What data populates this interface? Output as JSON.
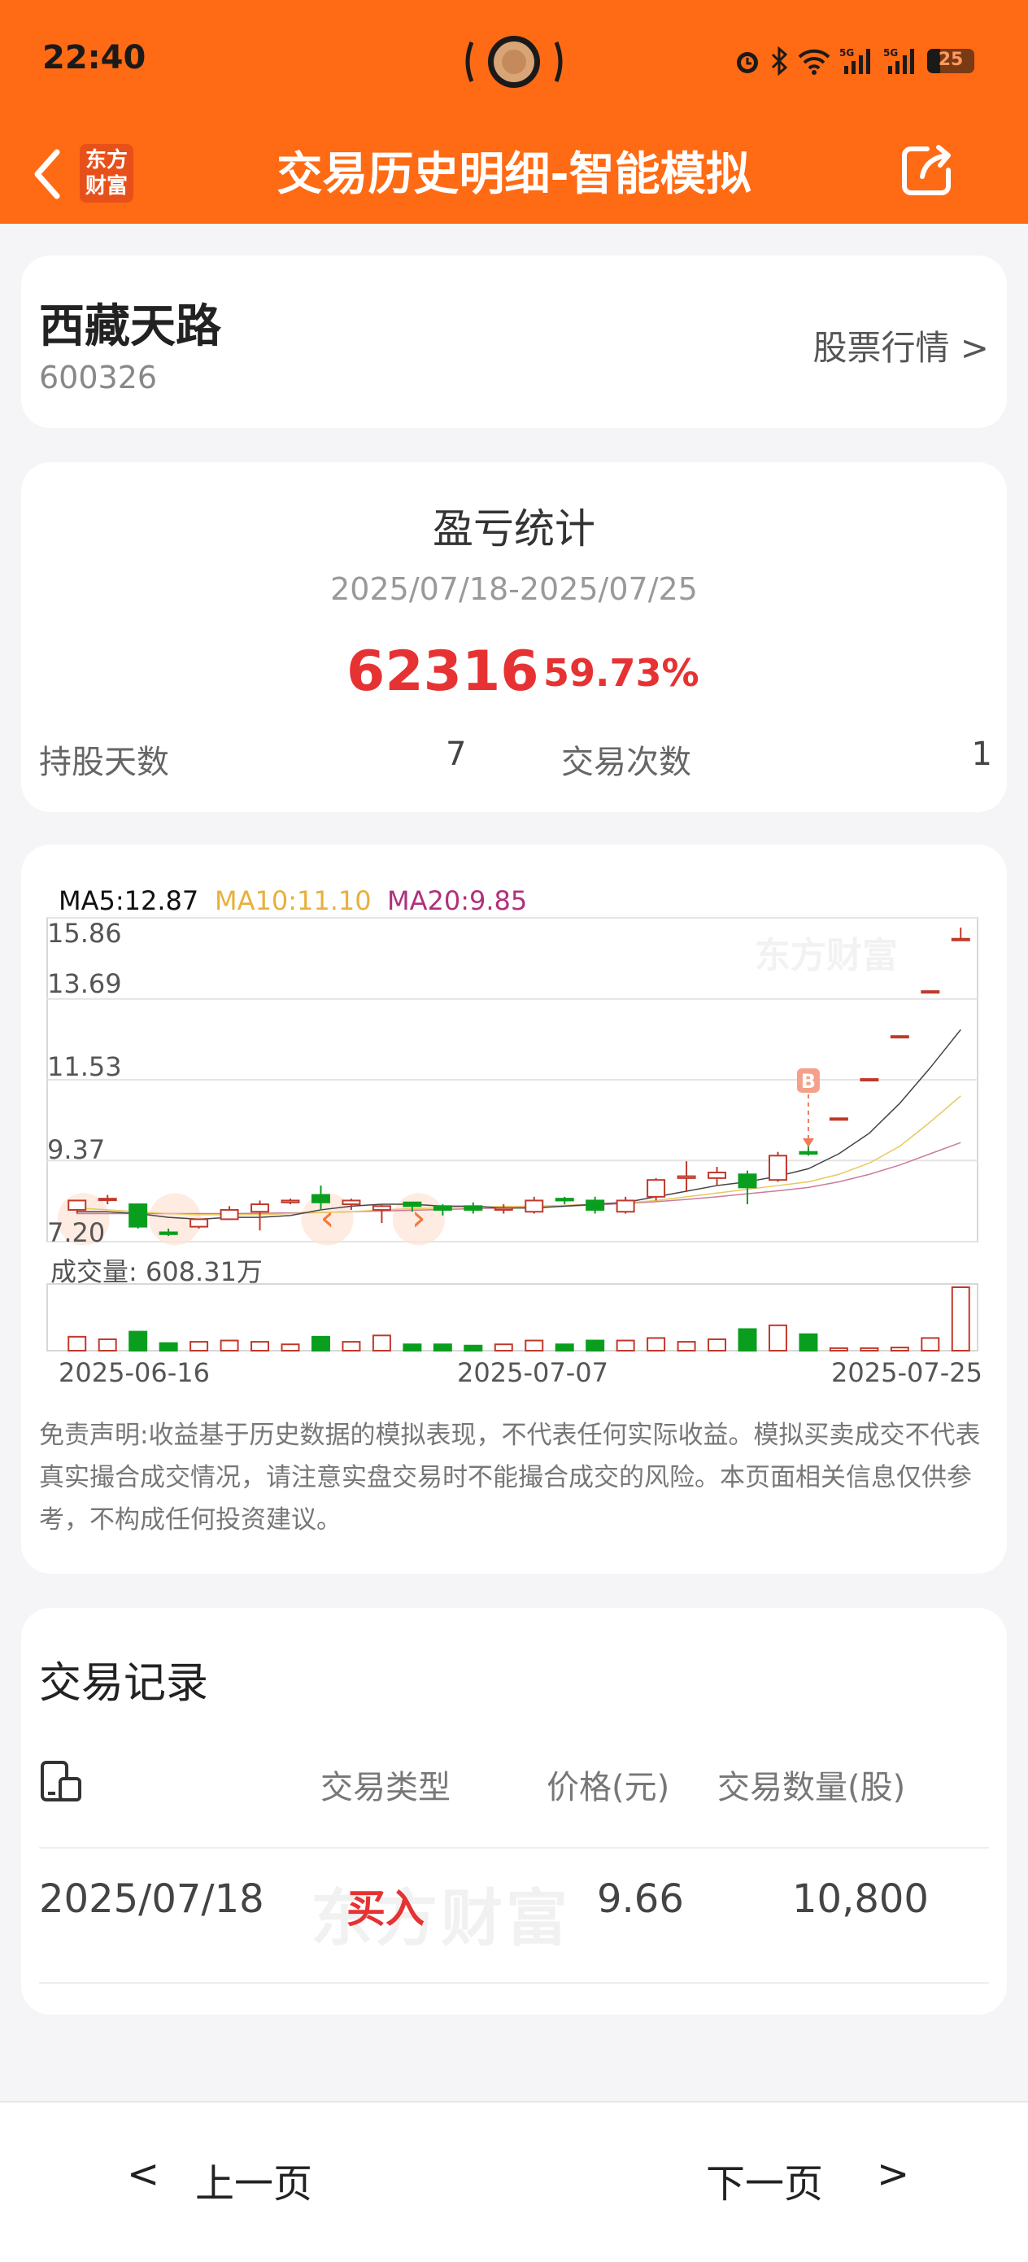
{
  "status_bar": {
    "time": "22:40",
    "battery": "25",
    "icons": [
      "alarm-icon",
      "bluetooth-icon",
      "wifi-icon",
      "signal-5g-icon",
      "signal-5g-icon",
      "battery-icon"
    ]
  },
  "header": {
    "logo_line1": "东方",
    "logo_line2": "财富",
    "title": "交易历史明细-智能模拟",
    "colors": {
      "brand": "#ff6a14"
    }
  },
  "stock": {
    "name": "西藏天路",
    "code": "600326",
    "quote_link": "股票行情 >"
  },
  "stats": {
    "title": "盈亏统计",
    "date_range": "2025/07/18-2025/07/25",
    "profit": "62316",
    "profit_pct": "59.73%",
    "hold_days_label": "持股天数",
    "hold_days": "7",
    "trade_count_label": "交易次数",
    "trade_count": "1"
  },
  "chart": {
    "ma5": "MA5:12.87",
    "ma10": "MA10:11.10",
    "ma20": "MA20:9.85",
    "y_ticks": [
      "15.86",
      "13.69",
      "11.53",
      "9.37",
      "7.20"
    ],
    "volume_label": "成交量: 608.31万",
    "x_ticks": [
      "2025-06-16",
      "2025-07-07",
      "2025-07-25"
    ],
    "watermark": "东方财富",
    "buy_marker": "B",
    "up_color": "#c0392b",
    "down_color": "#0a9e1e"
  },
  "chart_data": {
    "type": "candlestick",
    "ylim": [
      7.2,
      15.86
    ],
    "y_ticks": [
      15.86,
      13.69,
      11.53,
      9.37,
      7.2
    ],
    "x_ticks": [
      "2025-06-16",
      "2025-07-07",
      "2025-07-25"
    ],
    "candles": [
      {
        "o": 8.05,
        "h": 8.25,
        "l": 7.95,
        "c": 8.3,
        "v": 0.22
      },
      {
        "o": 8.35,
        "h": 8.45,
        "l": 8.2,
        "c": 8.35,
        "v": 0.18
      },
      {
        "o": 8.2,
        "h": 8.2,
        "l": 7.55,
        "c": 7.6,
        "v": 0.3
      },
      {
        "o": 7.45,
        "h": 7.55,
        "l": 7.35,
        "c": 7.4,
        "v": 0.12
      },
      {
        "o": 7.6,
        "h": 7.8,
        "l": 7.55,
        "c": 7.8,
        "v": 0.14
      },
      {
        "o": 7.8,
        "h": 8.15,
        "l": 7.78,
        "c": 8.05,
        "v": 0.16
      },
      {
        "o": 8.0,
        "h": 8.3,
        "l": 7.5,
        "c": 8.2,
        "v": 0.14
      },
      {
        "o": 8.25,
        "h": 8.35,
        "l": 8.2,
        "c": 8.3,
        "v": 0.1
      },
      {
        "o": 8.45,
        "h": 8.7,
        "l": 8.05,
        "c": 8.25,
        "v": 0.22
      },
      {
        "o": 8.2,
        "h": 8.35,
        "l": 8.05,
        "c": 8.3,
        "v": 0.14
      },
      {
        "o": 8.05,
        "h": 8.2,
        "l": 7.7,
        "c": 8.15,
        "v": 0.24
      },
      {
        "o": 8.25,
        "h": 8.25,
        "l": 8.0,
        "c": 8.15,
        "v": 0.1
      },
      {
        "o": 8.15,
        "h": 8.2,
        "l": 7.9,
        "c": 8.05,
        "v": 0.1
      },
      {
        "o": 8.15,
        "h": 8.25,
        "l": 7.95,
        "c": 8.05,
        "v": 0.08
      },
      {
        "o": 8.05,
        "h": 8.2,
        "l": 7.95,
        "c": 8.1,
        "v": 0.1
      },
      {
        "o": 8.0,
        "h": 8.4,
        "l": 7.95,
        "c": 8.3,
        "v": 0.16
      },
      {
        "o": 8.35,
        "h": 8.4,
        "l": 8.2,
        "c": 8.3,
        "v": 0.1
      },
      {
        "o": 8.3,
        "h": 8.4,
        "l": 7.95,
        "c": 8.05,
        "v": 0.16
      },
      {
        "o": 8.0,
        "h": 8.4,
        "l": 7.95,
        "c": 8.3,
        "v": 0.16
      },
      {
        "o": 8.4,
        "h": 8.9,
        "l": 8.3,
        "c": 8.85,
        "v": 0.2
      },
      {
        "o": 8.9,
        "h": 9.35,
        "l": 8.55,
        "c": 8.95,
        "v": 0.14
      },
      {
        "o": 8.9,
        "h": 9.2,
        "l": 8.7,
        "c": 9.05,
        "v": 0.18
      },
      {
        "o": 9.0,
        "h": 9.1,
        "l": 8.2,
        "c": 8.65,
        "v": 0.34
      },
      {
        "o": 8.85,
        "h": 9.6,
        "l": 8.8,
        "c": 9.5,
        "v": 0.4
      },
      {
        "o": 9.6,
        "h": 9.8,
        "l": 9.5,
        "c": 9.55,
        "v": 0.26
      },
      {
        "o": 10.5,
        "h": 10.5,
        "l": 10.5,
        "c": 10.5,
        "v": 0.04
      },
      {
        "o": 11.55,
        "h": 11.55,
        "l": 11.55,
        "c": 11.55,
        "v": 0.04
      },
      {
        "o": 12.7,
        "h": 12.7,
        "l": 12.7,
        "c": 12.7,
        "v": 0.05
      },
      {
        "o": 13.9,
        "h": 13.9,
        "l": 13.9,
        "c": 13.9,
        "v": 0.2
      },
      {
        "o": 15.3,
        "h": 15.6,
        "l": 15.3,
        "c": 15.3,
        "v": 1.0
      }
    ],
    "ma5": [
      8.0,
      8.0,
      7.95,
      7.85,
      7.8,
      7.85,
      7.85,
      7.9,
      8.05,
      8.15,
      8.2,
      8.2,
      8.15,
      8.15,
      8.1,
      8.1,
      8.15,
      8.2,
      8.25,
      8.4,
      8.55,
      8.7,
      8.8,
      8.95,
      9.15,
      9.55,
      10.1,
      10.9,
      11.85,
      12.87
    ],
    "ma10": [
      8.1,
      8.05,
      8.0,
      7.95,
      7.92,
      7.92,
      7.92,
      7.95,
      7.98,
      8.0,
      8.05,
      8.08,
      8.1,
      8.12,
      8.14,
      8.15,
      8.17,
      8.2,
      8.24,
      8.3,
      8.4,
      8.5,
      8.6,
      8.7,
      8.8,
      9.0,
      9.3,
      9.75,
      10.4,
      11.1
    ],
    "ma20": [
      7.95,
      7.95,
      7.95,
      7.95,
      7.95,
      7.95,
      7.96,
      7.97,
      7.98,
      8.0,
      8.02,
      8.04,
      8.06,
      8.08,
      8.1,
      8.12,
      8.15,
      8.18,
      8.22,
      8.27,
      8.33,
      8.4,
      8.48,
      8.56,
      8.65,
      8.8,
      9.0,
      9.25,
      9.55,
      9.85
    ],
    "buy_index": 24,
    "buy_price": 9.66,
    "volume_latest": "608.31万"
  },
  "disclaimer": "免责声明:收益基于历史数据的模拟表现，不代表任何实际收益。模拟买卖成交不代表真实撮合成交情况，请注意实盘交易时不能撮合成交的风险。本页面相关信息仅供参考，不构成任何投资建议。",
  "records": {
    "title": "交易记录",
    "headers": {
      "type": "交易类型",
      "price": "价格(元)",
      "qty": "交易数量(股)"
    },
    "rows": [
      {
        "date": "2025/07/18",
        "type": "买入",
        "price": "9.66",
        "qty": "10,800"
      }
    ]
  },
  "pager": {
    "prev": "上一页",
    "next": "下一页",
    "prev_arrow": "<",
    "next_arrow": ">"
  }
}
